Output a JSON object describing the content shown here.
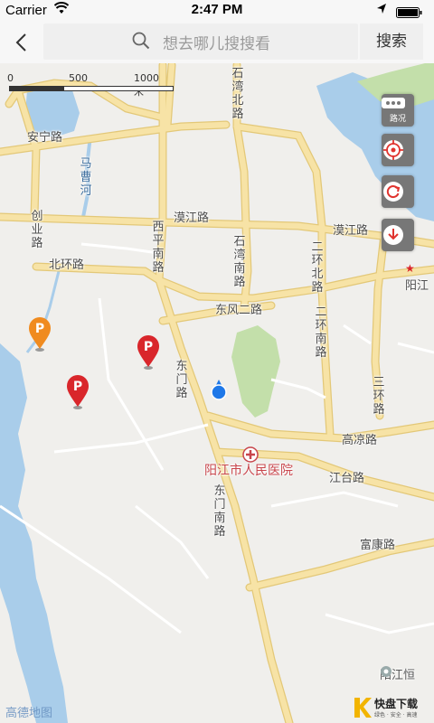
{
  "status": {
    "carrier": "Carrier",
    "time": "2:47 PM"
  },
  "search": {
    "placeholder": "想去哪儿搜搜看",
    "button": "搜索"
  },
  "scale": {
    "t0": "0",
    "t1": "500",
    "t2": "1000 米"
  },
  "roads": {
    "anning": "安宁路",
    "shiwan": "石湾北路",
    "chuangye": "创业路",
    "hanjiang1": "漠江路",
    "hanjiang2": "漠江路",
    "xiping": "西平南路",
    "shiwan_s": "石湾南路",
    "erhuan": "二环北路",
    "beihuan": "北环路",
    "dongfeng": "东风二路",
    "erhuan_s": "二环南路",
    "dongmen": "东门路",
    "sanhuan": "三环路",
    "gaoliang": "高凉路",
    "jiangtai": "江台路",
    "dongmen_s": "东门南路",
    "fukang": "富康路"
  },
  "water": {
    "macaohe": "马曹河"
  },
  "pois": {
    "hospital": "阳江市人民医院",
    "yang_right": "阳江",
    "yangjiang_heng": "阳江恒"
  },
  "controls": {
    "traffic": "路况"
  },
  "footer": {
    "amap": "高德地图",
    "brand": "快盘下载",
    "brand_sub": "绿色 · 安全 · 高速"
  },
  "colors": {
    "road": "#f5df9b",
    "road_border": "#e3c878",
    "water": "#a9cdea",
    "park": "#c3dfaa",
    "marker_red": "#d9262b",
    "marker_orange": "#f08b1f",
    "location": "#1e78e8"
  }
}
